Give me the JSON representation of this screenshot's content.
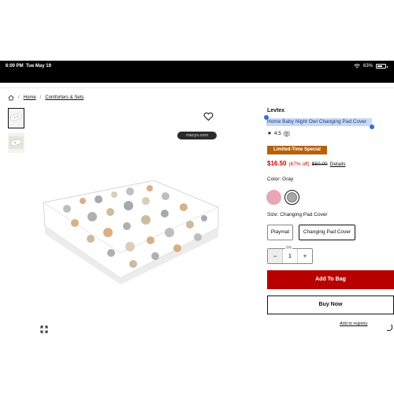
{
  "status_bar": {
    "time": "6:00 PM",
    "date": "Tue May 19",
    "battery": "63%",
    "battery_level": 0.63
  },
  "url": "macys.com",
  "breadcrumb": [
    "Home",
    "Comforters & Sets"
  ],
  "product": {
    "brand": "Levtex",
    "title": "Home Baby Night Owl Changing Pad Cover",
    "rating": "4.5",
    "review_count": "(8)",
    "badge": "Limited-Time Special",
    "price": "$16.50",
    "discount": "(67% off)",
    "original_price": "$50.00",
    "details_link": "Details"
  },
  "color": {
    "label": "Color: Gray",
    "options": [
      {
        "name": "pink",
        "hex": "#e7a7b5"
      },
      {
        "name": "gray",
        "hex": "#a8a8a8"
      }
    ]
  },
  "size": {
    "label": "Size: Changing Pad Cover",
    "options": [
      "Playmat",
      "Changing Pad Cover"
    ],
    "selected": "Changing Pad Cover"
  },
  "quantity": {
    "label": "Qty",
    "value": "1",
    "minus": "−",
    "plus": "+"
  },
  "actions": {
    "add_to_bag": "Add To Bag",
    "buy_now": "Buy Now",
    "add_to_registry": "Add to registry"
  },
  "colors": {
    "accent_red": "#b80000",
    "badge_orange": "#b5620b",
    "selection_blue": "#c9d9f3"
  }
}
